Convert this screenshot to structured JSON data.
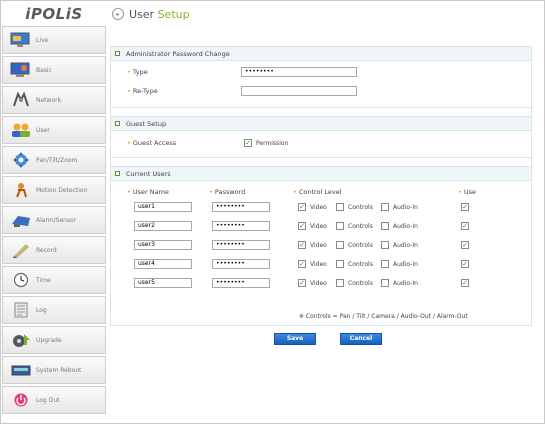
{
  "logo": "iPOLiS",
  "sidebar": {
    "items": [
      {
        "label": "Live",
        "icon": "monitor-icon"
      },
      {
        "label": "Basic",
        "icon": "monitor-basic-icon"
      },
      {
        "label": "Network",
        "icon": "network-icon"
      },
      {
        "label": "User",
        "icon": "users-icon"
      },
      {
        "label": "Pan/Tilt/Zoom",
        "icon": "ptz-icon"
      },
      {
        "label": "Motion Detection",
        "icon": "motion-icon"
      },
      {
        "label": "Alarm/Sensor",
        "icon": "alarm-icon"
      },
      {
        "label": "Record",
        "icon": "record-icon"
      },
      {
        "label": "Time",
        "icon": "clock-icon"
      },
      {
        "label": "Log",
        "icon": "log-icon"
      },
      {
        "label": "Upgrade",
        "icon": "upgrade-icon"
      },
      {
        "label": "System Reboot",
        "icon": "reboot-icon"
      },
      {
        "label": "Log Out",
        "icon": "logout-icon"
      }
    ]
  },
  "header": {
    "title_part1": "User ",
    "title_part2": "Setup"
  },
  "admin": {
    "section_title": "Administrator Password Change",
    "type_label": "Type",
    "type_value": "••••••••",
    "retype_label": "Re-Type",
    "retype_value": ""
  },
  "guest": {
    "section_title": "Guest Setup",
    "access_label": "Guest Access",
    "permission_label": "Permission",
    "permission_checked": true
  },
  "users": {
    "section_title": "Current Users",
    "columns": {
      "name": "User Name",
      "password": "Password",
      "control": "Control Level",
      "use": "Use"
    },
    "option_labels": {
      "video": "Video",
      "controls": "Controls",
      "audio": "Audio-In"
    },
    "rows": [
      {
        "name": "user1",
        "password": "••••••••",
        "video": true,
        "controls": false,
        "audio": false,
        "use": true
      },
      {
        "name": "user2",
        "password": "••••••••",
        "video": true,
        "controls": false,
        "audio": false,
        "use": true
      },
      {
        "name": "user3",
        "password": "••••••••",
        "video": true,
        "controls": false,
        "audio": false,
        "use": true
      },
      {
        "name": "user4",
        "password": "••••••••",
        "video": true,
        "controls": false,
        "audio": false,
        "use": true
      },
      {
        "name": "user5",
        "password": "••••••••",
        "video": true,
        "controls": false,
        "audio": false,
        "use": true
      }
    ],
    "footnote": "※ Controls = Pan / Tilt / Camera / Audio-Out / Alarm-Out"
  },
  "buttons": {
    "save": "Save",
    "cancel": "Cancel"
  },
  "colors": {
    "accent": "#87b428",
    "button": "#1a5fc0",
    "logo": "#2f5fa8"
  }
}
